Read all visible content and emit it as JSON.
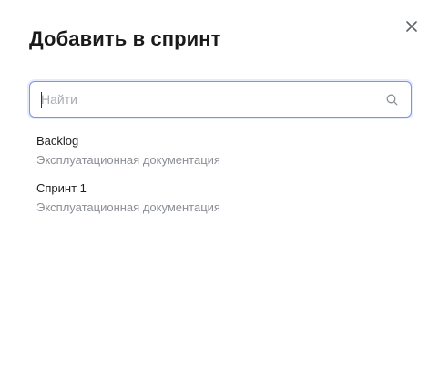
{
  "dialog": {
    "title": "Добавить в спринт",
    "close_icon": "close-icon"
  },
  "search": {
    "value": "",
    "placeholder": "Найти",
    "icon": "search-icon"
  },
  "sprints": [
    {
      "name": "Backlog",
      "project": "Эксплуатационная документация"
    },
    {
      "name": "Спринт 1",
      "project": "Эксплуатационная документация"
    }
  ],
  "colors": {
    "focus_border": "#7a93ef",
    "muted_text": "#8b8f96",
    "placeholder": "#a9acb3"
  }
}
